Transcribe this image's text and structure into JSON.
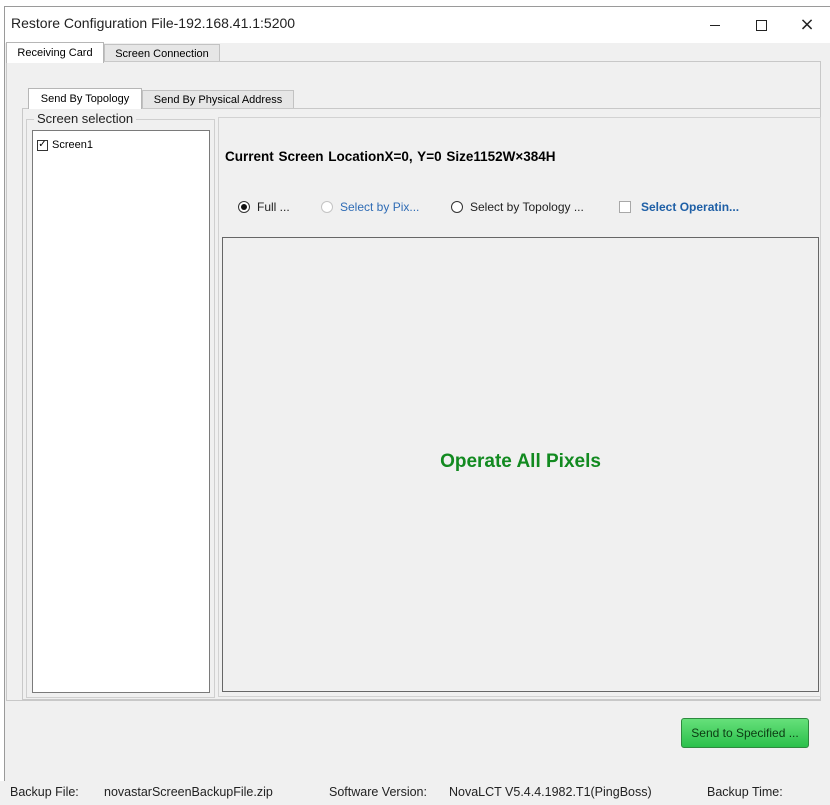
{
  "window": {
    "title": "Restore Configuration File-192.168.41.1:5200",
    "minimize_symbol": "",
    "close_symbol": "×"
  },
  "top_tabs": [
    {
      "label": "Receiving Card",
      "active": true
    },
    {
      "label": "Screen Connection",
      "active": false
    }
  ],
  "inner_tabs": [
    {
      "label": "Send By Topology",
      "active": true
    },
    {
      "label": "Send By Physical Address",
      "active": false
    }
  ],
  "screen_selection": {
    "title": "Screen selection",
    "items": [
      {
        "label": "Screen1",
        "checked": true
      }
    ]
  },
  "current_screen": {
    "text": "Current Screen  LocationX=0, Y=0  Size1152W×384H"
  },
  "options": {
    "full": {
      "label": "Full ...",
      "selected": true
    },
    "by_pixel": {
      "label": "Select by Pix...",
      "selected": false,
      "enabled": false
    },
    "by_topology": {
      "label": "Select by Topology ...",
      "selected": false
    },
    "select_operating": {
      "label": "Select Operatin...",
      "checked": false
    }
  },
  "canvas": {
    "message": "Operate All Pixels"
  },
  "actions": {
    "send_label": "Send to Specified ..."
  },
  "status": {
    "backup_file_label": "Backup File:",
    "backup_file_value": "novastarScreenBackupFile.zip",
    "software_version_label": "Software Version:",
    "software_version_value": "NovaLCT V5.4.4.1982.T1(PingBoss)",
    "backup_time_label": "Backup Time:"
  },
  "colors": {
    "operate_text": "#128a20",
    "send_button": "#2ac04b",
    "link_blue": "#2f6cb5"
  }
}
